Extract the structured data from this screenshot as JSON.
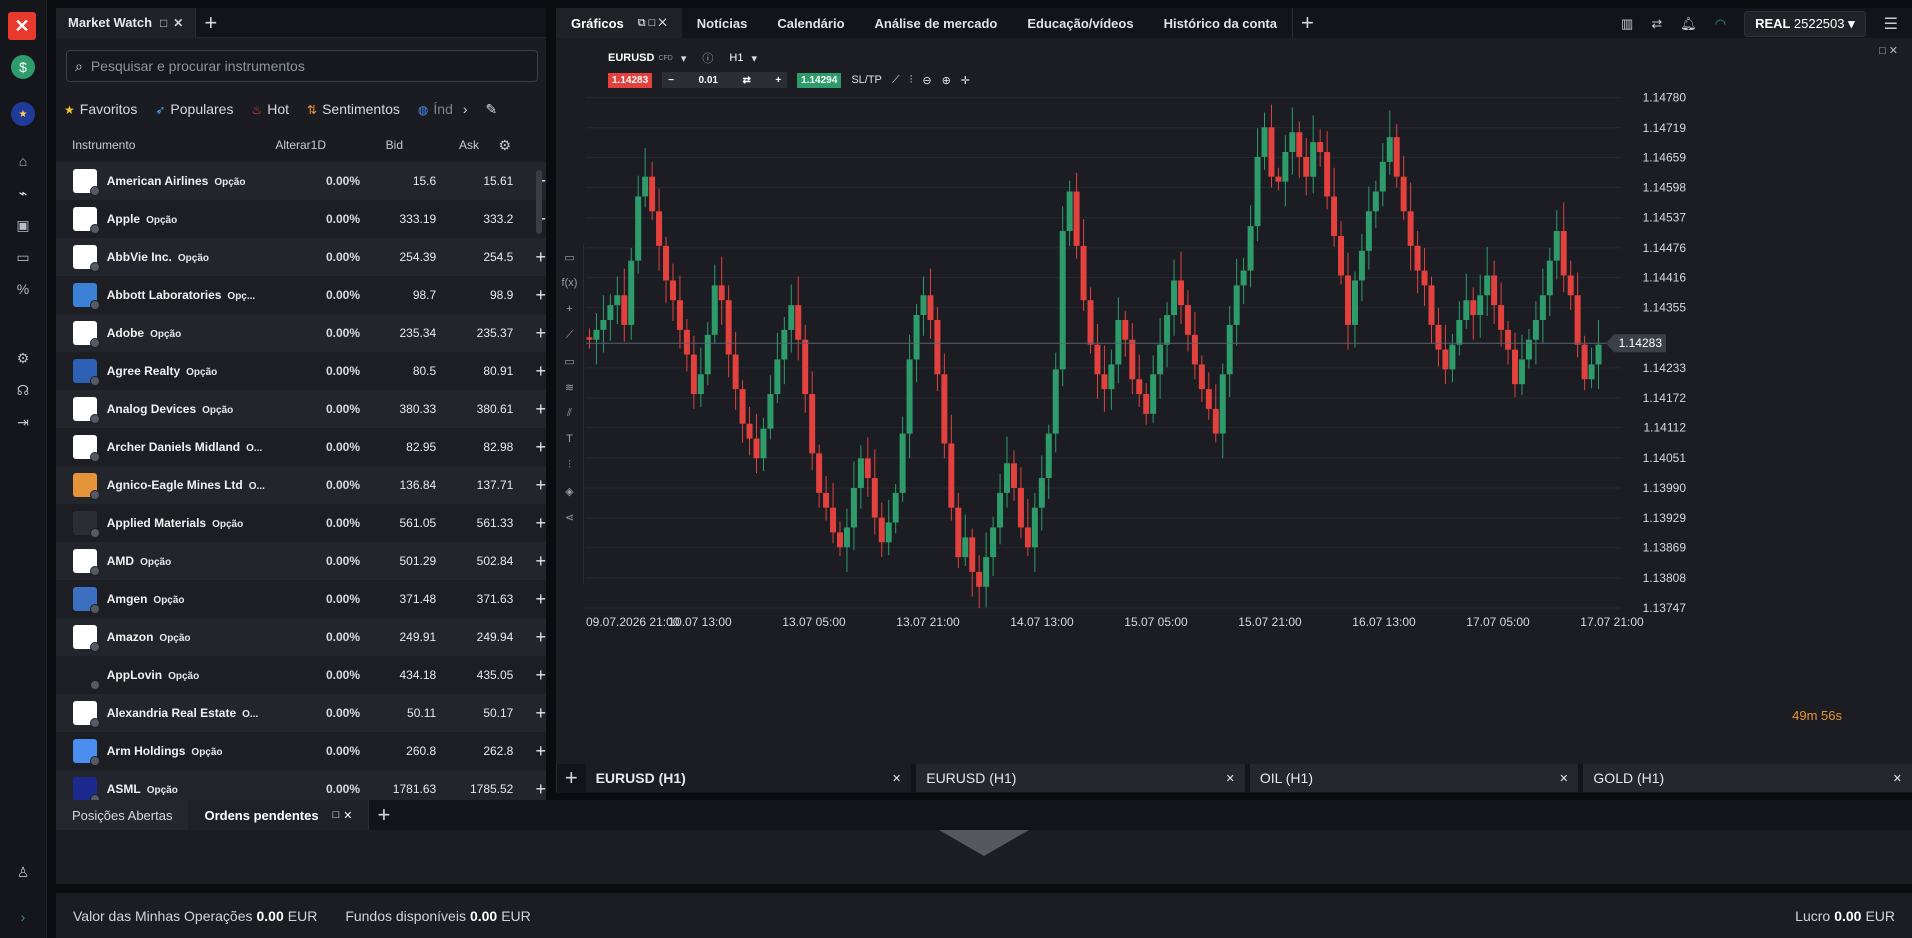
{
  "market_watch": {
    "title": "Market Watch",
    "search_placeholder": "Pesquisar e procurar instrumentos",
    "filters": [
      "Favoritos",
      "Populares",
      "Hot",
      "Sentimentos",
      "Índ"
    ],
    "columns": {
      "instrument": "Instrumento",
      "change": "Alterar1D",
      "bid": "Bid",
      "ask": "Ask"
    },
    "rows": [
      {
        "name": "American Airlines",
        "badge": "Opção",
        "change": "0.00%",
        "bid": "15.6",
        "ask": "15.61"
      },
      {
        "name": "Apple",
        "badge": "Opção",
        "change": "0.00%",
        "bid": "333.19",
        "ask": "333.2"
      },
      {
        "name": "AbbVie Inc.",
        "badge": "Opção",
        "change": "0.00%",
        "bid": "254.39",
        "ask": "254.5"
      },
      {
        "name": "Abbott Laboratories",
        "badge": "Opç...",
        "change": "0.00%",
        "bid": "98.7",
        "ask": "98.9"
      },
      {
        "name": "Adobe",
        "badge": "Opção",
        "change": "0.00%",
        "bid": "235.34",
        "ask": "235.37"
      },
      {
        "name": "Agree Realty",
        "badge": "Opção",
        "change": "0.00%",
        "bid": "80.5",
        "ask": "80.91"
      },
      {
        "name": "Analog Devices",
        "badge": "Opção",
        "change": "0.00%",
        "bid": "380.33",
        "ask": "380.61"
      },
      {
        "name": "Archer Daniels Midland",
        "badge": "O...",
        "change": "0.00%",
        "bid": "82.95",
        "ask": "82.98"
      },
      {
        "name": "Agnico-Eagle Mines Ltd",
        "badge": "O...",
        "change": "0.00%",
        "bid": "136.84",
        "ask": "137.71"
      },
      {
        "name": "Applied Materials",
        "badge": "Opção",
        "change": "0.00%",
        "bid": "561.05",
        "ask": "561.33"
      },
      {
        "name": "AMD",
        "badge": "Opção",
        "change": "0.00%",
        "bid": "501.29",
        "ask": "502.84"
      },
      {
        "name": "Amgen",
        "badge": "Opção",
        "change": "0.00%",
        "bid": "371.48",
        "ask": "371.63"
      },
      {
        "name": "Amazon",
        "badge": "Opção",
        "change": "0.00%",
        "bid": "249.91",
        "ask": "249.94"
      },
      {
        "name": "AppLovin",
        "badge": "Opção",
        "change": "0.00%",
        "bid": "434.18",
        "ask": "435.05"
      },
      {
        "name": "Alexandria Real Estate",
        "badge": "O...",
        "change": "0.00%",
        "bid": "50.11",
        "ask": "50.17"
      },
      {
        "name": "Arm Holdings",
        "badge": "Opção",
        "change": "0.00%",
        "bid": "260.8",
        "ask": "262.8"
      },
      {
        "name": "ASML",
        "badge": "Opção",
        "change": "0.00%",
        "bid": "1781.63",
        "ask": "1785.52"
      }
    ]
  },
  "top_tabs": [
    "Gráficos",
    "Notícias",
    "Calendário",
    "Análise de mercado",
    "Educação/vídeos",
    "Histórico da conta"
  ],
  "account": {
    "label": "REAL",
    "number": "2522503"
  },
  "chart": {
    "symbol": "EURUSD",
    "symbol_sub": "CFD",
    "timeframe": "H1",
    "sell_price": "1.14283",
    "buy_price": "1.14294",
    "quantity": "0.01",
    "sltp": "SL/TP",
    "current_price_label": "1.14283",
    "countdown": "49m 56s"
  },
  "chart_tabs": [
    "EURUSD (H1)",
    "EURUSD (H1)",
    "OIL (H1)",
    "GOLD (H1)"
  ],
  "lower_tabs": [
    "Posições Abertas",
    "Ordens pendentes"
  ],
  "footer": {
    "trades_label": "Valor das Minhas Operações",
    "trades_value": "0.00",
    "trades_ccy": "EUR",
    "funds_label": "Fundos disponíveis",
    "funds_value": "0.00",
    "funds_ccy": "EUR",
    "profit_label": "Lucro",
    "profit_value": "0.00",
    "profit_ccy": "EUR"
  },
  "colors": {
    "up": "#2e9c6a",
    "down": "#e2413e",
    "accent_orange": "#e6943b"
  },
  "chart_data": {
    "type": "candlestick",
    "y_ticks": [
      "1.14780",
      "1.14719",
      "1.14659",
      "1.14598",
      "1.14537",
      "1.14476",
      "1.14416",
      "1.14355",
      "1.14233",
      "1.14172",
      "1.14112",
      "1.14051",
      "1.13990",
      "1.13929",
      "1.13869",
      "1.13808",
      "1.13747"
    ],
    "x_ticks": [
      "09.07.2026 21:00",
      "10.07 13:00",
      "13.07 05:00",
      "13.07 21:00",
      "14.07 13:00",
      "15.07 05:00",
      "15.07 21:00",
      "16.07 13:00",
      "17.07 05:00",
      "17.07 21:00"
    ],
    "ylim": [
      1.13747,
      1.1484
    ],
    "current_price": 1.14283,
    "closes": [
      1.1429,
      1.1431,
      1.1433,
      1.1436,
      1.1438,
      1.1432,
      1.1445,
      1.1458,
      1.1462,
      1.1455,
      1.1448,
      1.1441,
      1.1437,
      1.1431,
      1.1426,
      1.1418,
      1.1422,
      1.143,
      1.144,
      1.1437,
      1.1426,
      1.1419,
      1.1412,
      1.1409,
      1.1405,
      1.1411,
      1.1418,
      1.1425,
      1.1431,
      1.1436,
      1.1429,
      1.1418,
      1.1406,
      1.1398,
      1.1395,
      1.139,
      1.1387,
      1.1391,
      1.1399,
      1.1405,
      1.1401,
      1.1393,
      1.1388,
      1.1392,
      1.1398,
      1.141,
      1.1425,
      1.1434,
      1.1438,
      1.1433,
      1.1422,
      1.1408,
      1.1395,
      1.1385,
      1.1389,
      1.1382,
      1.1379,
      1.1385,
      1.1391,
      1.1398,
      1.1404,
      1.1399,
      1.1391,
      1.1387,
      1.1395,
      1.1401,
      1.141,
      1.1423,
      1.1451,
      1.1459,
      1.1448,
      1.1437,
      1.1428,
      1.1422,
      1.1419,
      1.1424,
      1.1433,
      1.1429,
      1.1421,
      1.1418,
      1.1414,
      1.1422,
      1.1428,
      1.1434,
      1.1441,
      1.1436,
      1.143,
      1.1424,
      1.1419,
      1.1415,
      1.141,
      1.1422,
      1.1432,
      1.144,
      1.1443,
      1.1452,
      1.1466,
      1.1472,
      1.1462,
      1.1461,
      1.1467,
      1.1471,
      1.1466,
      1.1462,
      1.1469,
      1.1467,
      1.1458,
      1.145,
      1.1442,
      1.1432,
      1.1441,
      1.1447,
      1.1455,
      1.1459,
      1.1465,
      1.147,
      1.1462,
      1.1455,
      1.1448,
      1.1443,
      1.144,
      1.1432,
      1.1427,
      1.1423,
      1.1428,
      1.1433,
      1.1437,
      1.1434,
      1.1438,
      1.1442,
      1.1436,
      1.1431,
      1.1427,
      1.142,
      1.1425,
      1.1429,
      1.1433,
      1.1438,
      1.1445,
      1.1451,
      1.1442,
      1.1438,
      1.1428,
      1.1421,
      1.1424,
      1.1428
    ]
  }
}
